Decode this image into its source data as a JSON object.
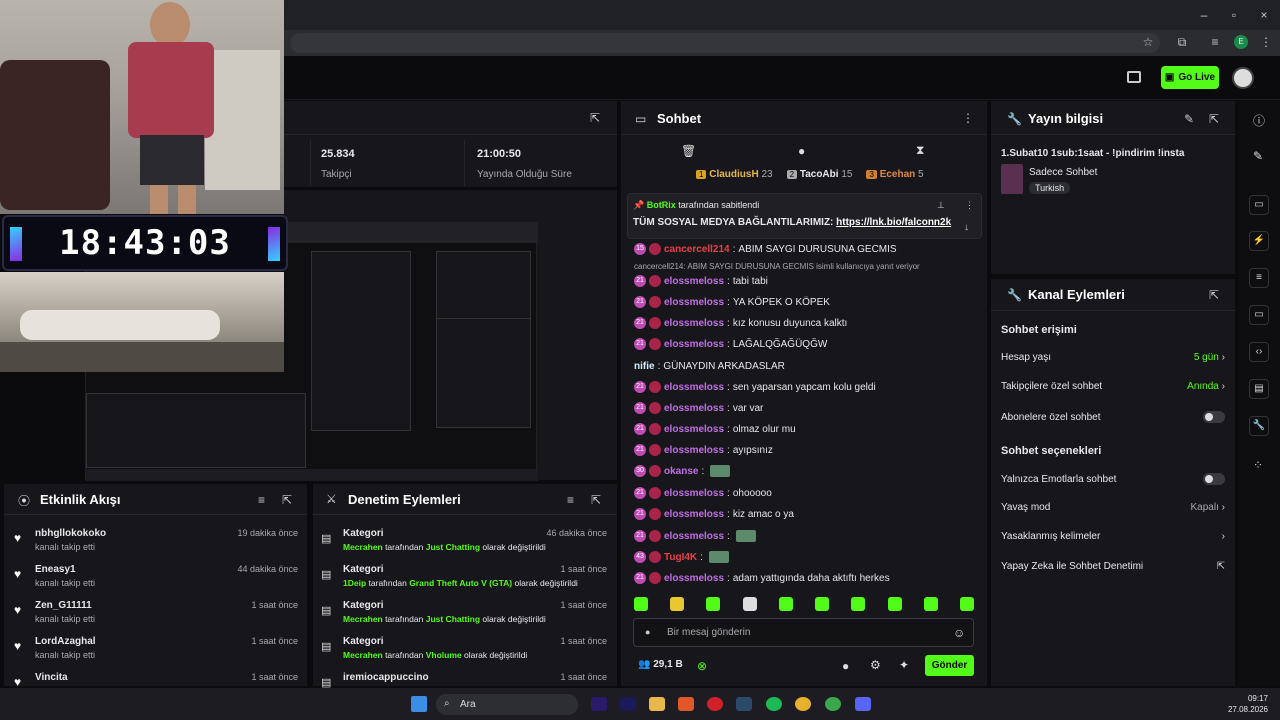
{
  "stats": {
    "followers_value": "25.834",
    "followers_label": "Takipçi",
    "uptime_value": "21:00:50",
    "uptime_label": "Yayında Olduğu Süre"
  },
  "clock": "18:43:03",
  "chat": {
    "title": "Sohbet",
    "leaderboard": [
      {
        "name": "ClaudiusH",
        "count": "23",
        "rank": "1"
      },
      {
        "name": "TacoAbi",
        "count": "15",
        "rank": "2"
      },
      {
        "name": "Ecehan",
        "count": "5",
        "rank": "3"
      }
    ],
    "pinned": {
      "by": "BotRix",
      "by_suffix": "tarafından sabitlendi",
      "text": "TÜM SOSYAL MEDYA BAĞLANTILARIMIZ: ",
      "link": "https://lnk.bio/falconn2k"
    },
    "reply_note": "cancercell214: ABIM SAYGI DURUSUNA GECMIS isimli kullanıcıya yanıt veriyor",
    "messages": [
      {
        "user": "cancercell214",
        "text": "ABIM SAYGI DURUSUNA GECMIS",
        "badge": "15"
      },
      {
        "user": "elossmeloss",
        "text": "tabi tabi",
        "badge": "21"
      },
      {
        "user": "elossmeloss",
        "text": "YA KÖPEK O KÖPEK",
        "badge": "21"
      },
      {
        "user": "elossmeloss",
        "text": "kız konusu duyunca kalktı",
        "badge": "21"
      },
      {
        "user": "elossmeloss",
        "text": "LAĞALQĞAĞÜQĞW",
        "badge": "21"
      },
      {
        "user": "nifie",
        "text": "GÜNAYDIN ARKADASLAR",
        "badge": ""
      },
      {
        "user": "elossmeloss",
        "text": "sen yaparsan yapcam kolu geldi",
        "badge": "21"
      },
      {
        "user": "elossmeloss",
        "text": "var var",
        "badge": "21"
      },
      {
        "user": "elossmeloss",
        "text": "olmaz olur mu",
        "badge": "21"
      },
      {
        "user": "elossmeloss",
        "text": "ayıpsınız",
        "badge": "21"
      },
      {
        "user": "okanse",
        "text": "",
        "badge": "30"
      },
      {
        "user": "elossmeloss",
        "text": "ohooooo",
        "badge": "21"
      },
      {
        "user": "elossmeloss",
        "text": "kiz amac o ya",
        "badge": "21"
      },
      {
        "user": "elossmeloss",
        "text": "",
        "badge": "21"
      },
      {
        "user": "TugI4K",
        "text": "",
        "badge": "43"
      },
      {
        "user": "elossmeloss",
        "text": "adam yattıgında daha aktıftı herkes",
        "badge": "21"
      }
    ],
    "input_placeholder": "Bir mesaj gönderin",
    "viewer_count": "29,1 B",
    "send_label": "Gönder"
  },
  "yayin": {
    "title": "Yayın bilgisi",
    "stream_title": "1.Subat10 1sub:1saat - !pindirim !insta",
    "category": "Sadece Sohbet",
    "tag": "Turkish"
  },
  "kanal": {
    "title": "Kanal Eylemleri",
    "access_title": "Sohbet erişimi",
    "hesap_label": "Hesap yaşı",
    "hesap_value": "5 gün",
    "takipci_label": "Takipçilere özel sohbet",
    "takipci_value": "Anında",
    "abone_label": "Abonelere özel sohbet",
    "options_title": "Sohbet seçenekleri",
    "emote_label": "Yalnızca Emotlarla sohbet",
    "yavas_label": "Yavaş mod",
    "yavas_value": "Kapalı",
    "yasak_label": "Yasaklanmış kelimeler",
    "ai_label": "Yapay Zeka ile Sohbet Denetimi"
  },
  "golive": "Go Live",
  "etkinlik": {
    "title": "Etkinlik Akışı",
    "items": [
      {
        "name": "nbhgllokokoko",
        "sub": "kanalı takip etti",
        "time": "19 dakika önce"
      },
      {
        "name": "Eneasy1",
        "sub": "kanalı takip etti",
        "time": "44 dakika önce"
      },
      {
        "name": "Zen_G11111",
        "sub": "kanalı takip etti",
        "time": "1 saat önce"
      },
      {
        "name": "LordAzaghal",
        "sub": "kanalı takip etti",
        "time": "1 saat önce"
      },
      {
        "name": "Vincita",
        "sub": "",
        "time": "1 saat önce"
      }
    ]
  },
  "denetim": {
    "title": "Denetim Eylemleri",
    "items": [
      {
        "head": "Kategori",
        "who": "Mecrahen",
        "mid": "tarafından",
        "cat": "Just Chatting",
        "tail": "olarak değiştirildi",
        "time": "46 dakika önce"
      },
      {
        "head": "Kategori",
        "who": "1Deip",
        "mid": "tarafından",
        "cat": "Grand Theft Auto V (GTA)",
        "tail": "olarak değiştirildi",
        "time": "1 saat önce"
      },
      {
        "head": "Kategori",
        "who": "Mecrahen",
        "mid": "tarafından",
        "cat": "Just Chatting",
        "tail": "olarak değiştirildi",
        "time": "1 saat önce"
      },
      {
        "head": "Kategori",
        "who": "Mecrahen",
        "mid": "tarafından",
        "cat": "Vholume",
        "tail": "olarak değiştirildi",
        "time": "1 saat önce"
      },
      {
        "head": "iremiocappuccino",
        "who": "",
        "mid": "",
        "cat": "",
        "tail": "",
        "time": "1 saat önce"
      }
    ]
  },
  "taskbar": {
    "search": "Ara",
    "time": "09:17",
    "date": "27.08.2026"
  },
  "colors": {
    "accent": "#53fc18",
    "panel": "#17171b",
    "username": "#c36ee8"
  }
}
